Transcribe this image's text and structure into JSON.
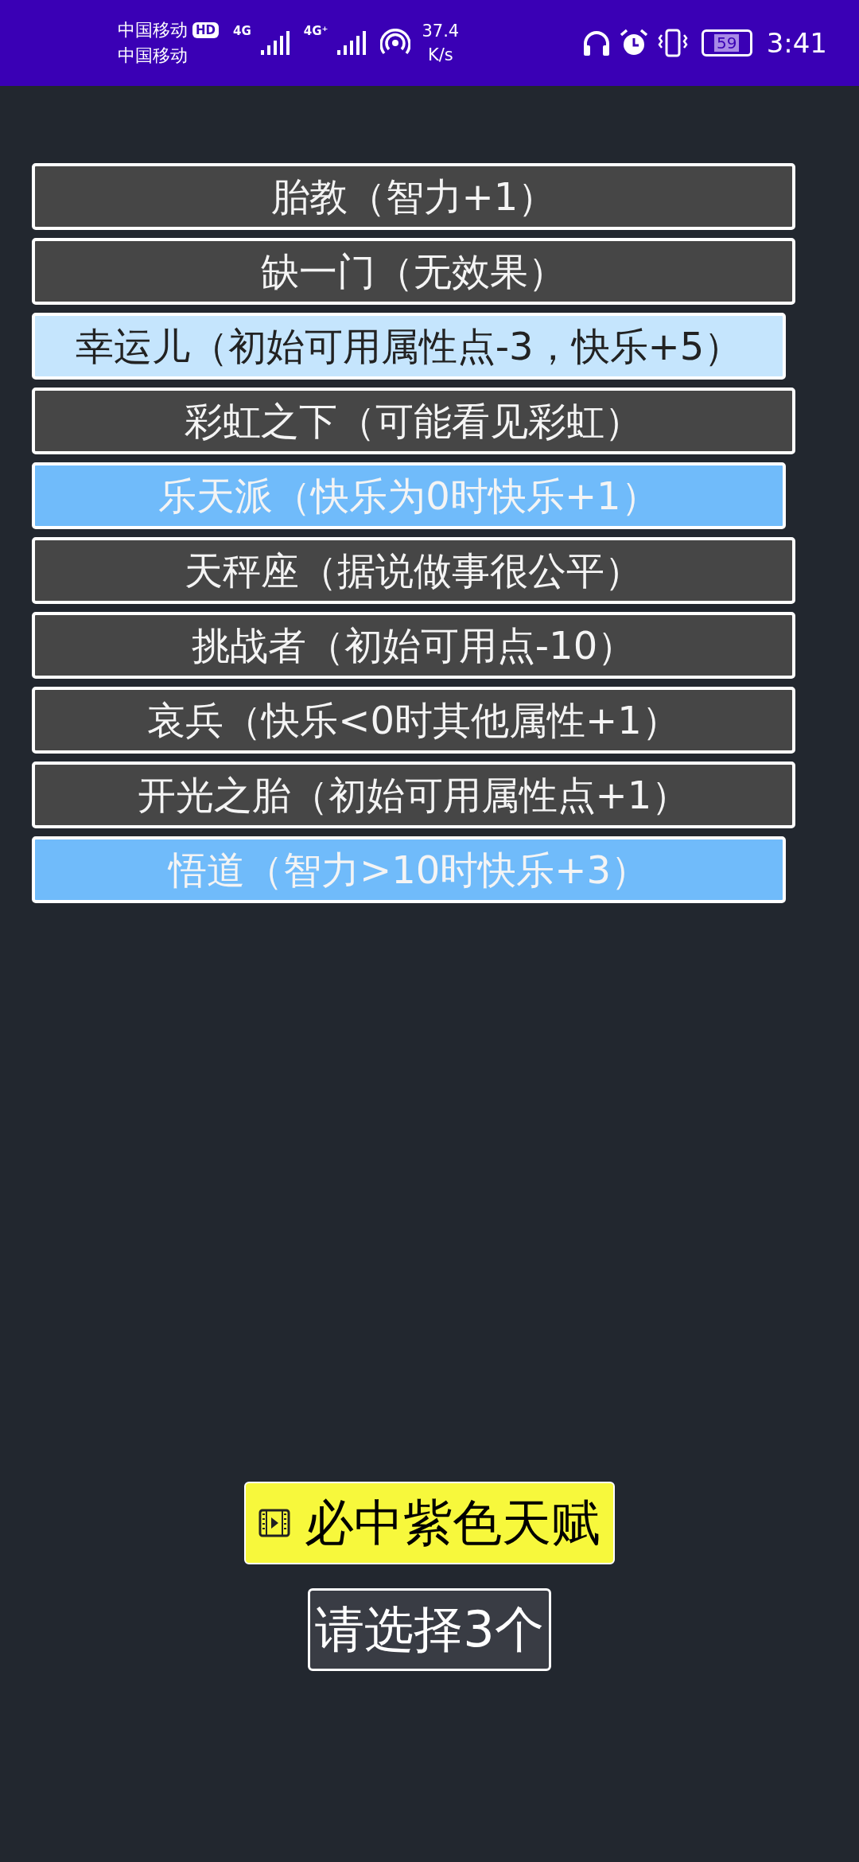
{
  "status_bar": {
    "carrier_1": "中国移动",
    "hd_badge": "HD",
    "carrier_2": "中国移动",
    "network_1": "4G",
    "network_2": "4G⁺",
    "speed_value": "37.4",
    "speed_unit": "K/s",
    "battery": "59",
    "time": "3:41"
  },
  "talents": [
    {
      "label": "胎教（智力+1）",
      "color": "#464646"
    },
    {
      "label": "缺一门（无效果）",
      "color": "#464646"
    },
    {
      "label": "幸运儿（初始可用属性点-3，快乐+5）",
      "color": "#c5e5fd"
    },
    {
      "label": "彩虹之下（可能看见彩虹）",
      "color": "#464646"
    },
    {
      "label": "乐天派（快乐为0时快乐+1）",
      "color": "#70bbfa"
    },
    {
      "label": "天秤座（据说做事很公平）",
      "color": "#464646"
    },
    {
      "label": "挑战者（初始可用点-10）",
      "color": "#464646"
    },
    {
      "label": "哀兵（快乐<0时其他属性+1）",
      "color": "#464646"
    },
    {
      "label": "开光之胎（初始可用属性点+1）",
      "color": "#464646"
    },
    {
      "label": "悟道（智力>10时快乐+3）",
      "color": "#70bbfa"
    }
  ],
  "ad_button": "必中紫色天赋",
  "confirm_button": "请选择3个"
}
